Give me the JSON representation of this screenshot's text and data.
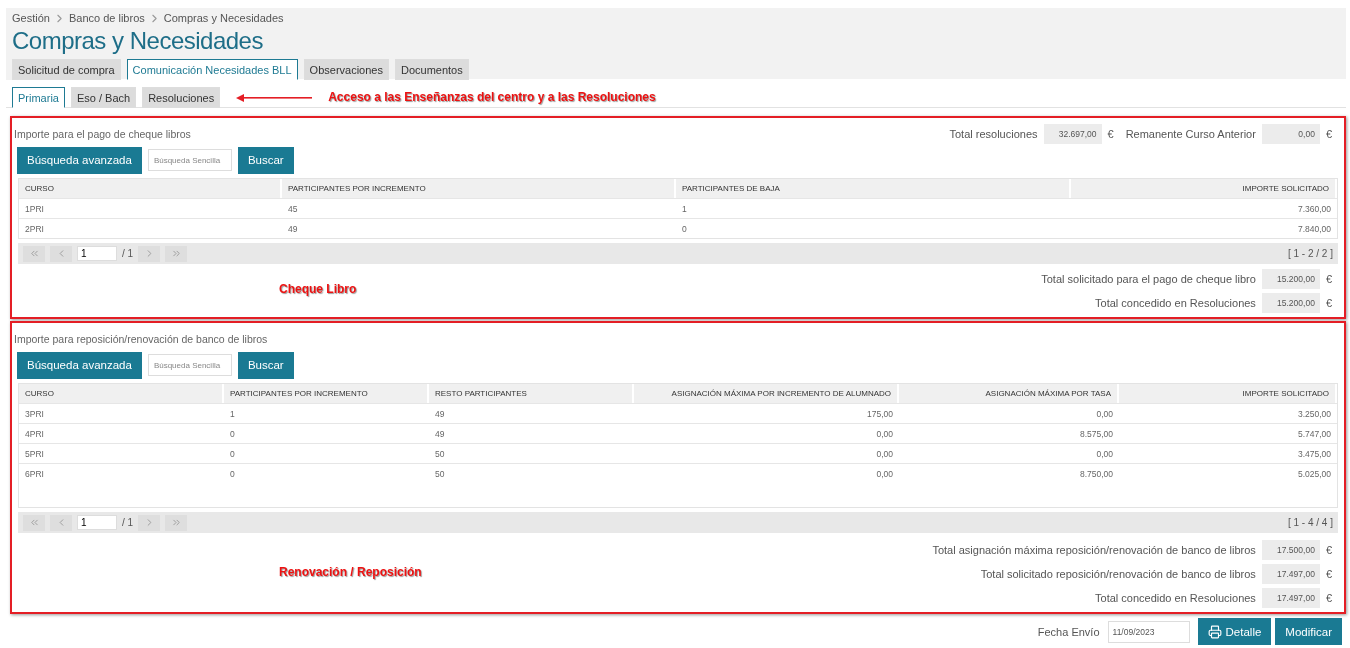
{
  "breadcrumb": [
    "Gestión",
    "Banco de libros",
    "Compras y Necesidades"
  ],
  "title": "Compras y Necesidades",
  "tabs": [
    {
      "label": "Solicitud de compra",
      "selected": false
    },
    {
      "label": "Comunicación Necesidades BLL",
      "selected": true
    },
    {
      "label": "Observaciones",
      "selected": false
    },
    {
      "label": "Documentos",
      "selected": false
    }
  ],
  "subtabs": [
    {
      "label": "Primaria",
      "selected": true
    },
    {
      "label": "Eso / Bach",
      "selected": false
    },
    {
      "label": "Resoluciones",
      "selected": false
    }
  ],
  "subtabs_annotation": "Acceso a las Enseñanzas del centro y a las Resoluciones",
  "sections": [
    {
      "title": "Importe para el pago de cheque libros",
      "advanced_button": "Búsqueda avanzada",
      "search_placeholder": "Búsqueda Sencilla",
      "search_button": "Buscar",
      "header_totals": [
        {
          "label": "Total resoluciones",
          "value": "32.697,00",
          "currency": "€"
        },
        {
          "label": "Remanente Curso Anterior",
          "value": "0,00",
          "currency": "€"
        }
      ],
      "columns": [
        "CURSO",
        "PARTICIPANTES POR INCREMENTO",
        "PARTICIPANTES DE BAJA",
        "IMPORTE SOLICITADO"
      ],
      "rows": [
        [
          "1PRI",
          "45",
          "1",
          "7.360,00"
        ],
        [
          "2PRI",
          "49",
          "0",
          "7.840,00"
        ]
      ],
      "pager": {
        "page": "1",
        "pages": "/ 1",
        "range": "[ 1 - 2 / 2 ]"
      },
      "annotation": "Cheque Libro",
      "totals": [
        {
          "label": "Total solicitado para el pago de cheque libro",
          "value": "15.200,00",
          "currency": "€"
        },
        {
          "label": "Total concedido en Resoluciones",
          "value": "15.200,00",
          "currency": "€"
        }
      ]
    },
    {
      "title": "Importe para reposición/renovación de banco de libros",
      "advanced_button": "Búsqueda avanzada",
      "search_placeholder": "Búsqueda Sencilla",
      "search_button": "Buscar",
      "columns": [
        "CURSO",
        "PARTICIPANTES POR INCREMENTO",
        "RESTO PARTICIPANTES",
        "ASIGNACIÓN MÁXIMA POR INCREMENTO DE ALUMNADO",
        "ASIGNACIÓN MÁXIMA POR TASA",
        "IMPORTE SOLICITADO"
      ],
      "rows": [
        [
          "3PRI",
          "1",
          "49",
          "175,00",
          "0,00",
          "3.250,00"
        ],
        [
          "4PRI",
          "0",
          "49",
          "0,00",
          "8.575,00",
          "5.747,00"
        ],
        [
          "5PRI",
          "0",
          "50",
          "0,00",
          "0,00",
          "3.475,00"
        ],
        [
          "6PRI",
          "0",
          "50",
          "0,00",
          "8.750,00",
          "5.025,00"
        ]
      ],
      "pager": {
        "page": "1",
        "pages": "/ 1",
        "range": "[ 1 - 4 / 4 ]"
      },
      "annotation": "Renovación / Reposición",
      "totals": [
        {
          "label": "Total asignación máxima reposición/renovación de banco de libros",
          "value": "17.500,00",
          "currency": "€"
        },
        {
          "label": "Total solicitado reposición/renovación de banco de libros",
          "value": "17.497,00",
          "currency": "€"
        },
        {
          "label": "Total concedido en Resoluciones",
          "value": "17.497,00",
          "currency": "€"
        }
      ]
    }
  ],
  "footer": {
    "date_label": "Fecha Envío",
    "date_value": "11/09/2023",
    "buttons": [
      {
        "label": "Detalle",
        "kind": "print"
      },
      {
        "label": "Modificar",
        "kind": "plain"
      }
    ]
  }
}
